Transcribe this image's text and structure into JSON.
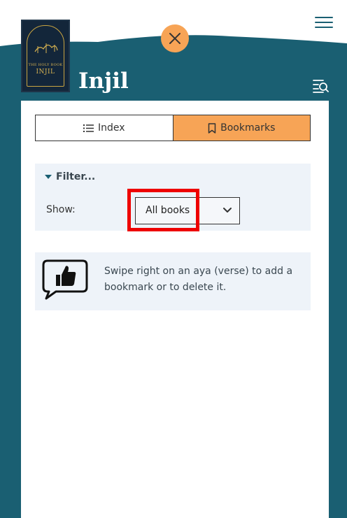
{
  "app": {
    "title": "Injil",
    "cover": {
      "subtitle": "THE HOLY BOOK",
      "title": "INJIL"
    }
  },
  "tabs": [
    {
      "label": "Index",
      "icon": "list-icon",
      "active": false
    },
    {
      "label": "Bookmarks",
      "icon": "bookmark-icon",
      "active": true
    }
  ],
  "filter": {
    "toggle_label": "Filter...",
    "show_label": "Show:",
    "selected": "All books"
  },
  "info": {
    "text": "Swipe right on an aya (verse) to add a bookmark or to delete it."
  },
  "colors": {
    "teal": "#1a5f72",
    "accent": "#f7a456",
    "light_panel": "#eef3f9",
    "highlight": "#ee0000"
  }
}
